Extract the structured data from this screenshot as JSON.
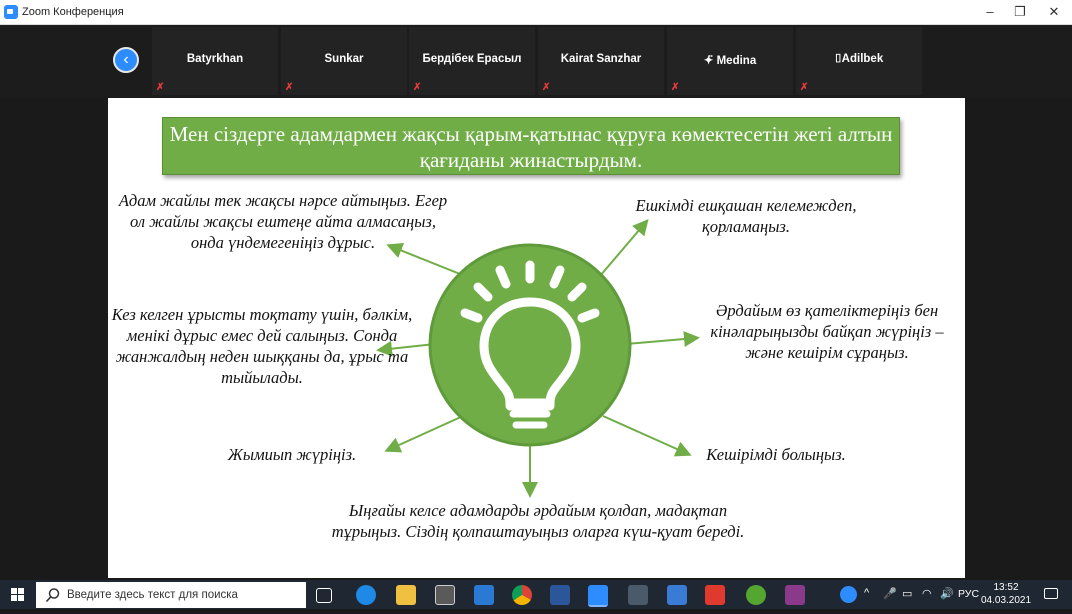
{
  "window": {
    "title": "Zoom Конференция",
    "minimize": "–",
    "restore": "❐",
    "close": "✕"
  },
  "participants": [
    {
      "name": "Batyrkhan",
      "muted": "✗"
    },
    {
      "name": "Sunkar",
      "muted": "✗"
    },
    {
      "name": "Бердібек Ерасыл",
      "muted": "✗"
    },
    {
      "name": "Kairat Sanzhar",
      "muted": "✗"
    },
    {
      "name": "✦̈ Medina",
      "muted": "✗"
    },
    {
      "name": "⌷Adilbek",
      "muted": "✗"
    }
  ],
  "back_button": "‹",
  "slide": {
    "banner": "Мен сіздерге адамдармен жақсы қарым-қатынас құруға көмектесетін жеті алтын қағиданы жинастырдым.",
    "tips": [
      "Адам жайлы тек жақсы нәрсе айтыңыз. Егер ол жайлы жақсы ештеңе айта алмасаңыз, онда үндемегеніңіз дұрыс.",
      "Кез келген ұрысты тоқтату үшін, бәлкім, менікі дұрыс емес дей салыңыз. Сонда жанжалдың неден шыққаны да, ұрыс та тыйылады.",
      "Жымиып жүріңіз.",
      "Ыңғайы келсе адамдарды әрдайым қолдап, мадақтап тұрыңыз. Сіздің қолпаштауыңыз оларға күш-қуат береді.",
      "Кешірімді болыңыз.",
      "Әрдайым өз қателіктеріңіз бен кінәларыңызды байқап жүріңіз – және кешірім сұраңыз.",
      "Ешкімді ешқашан келемеждеп, қорламаңыз."
    ],
    "colors": {
      "green": "#70ad47"
    }
  },
  "taskbar": {
    "search_placeholder": "Введите здесь текст для поиска",
    "language": "РУС",
    "time": "13:52",
    "date": "04.03.2021"
  }
}
